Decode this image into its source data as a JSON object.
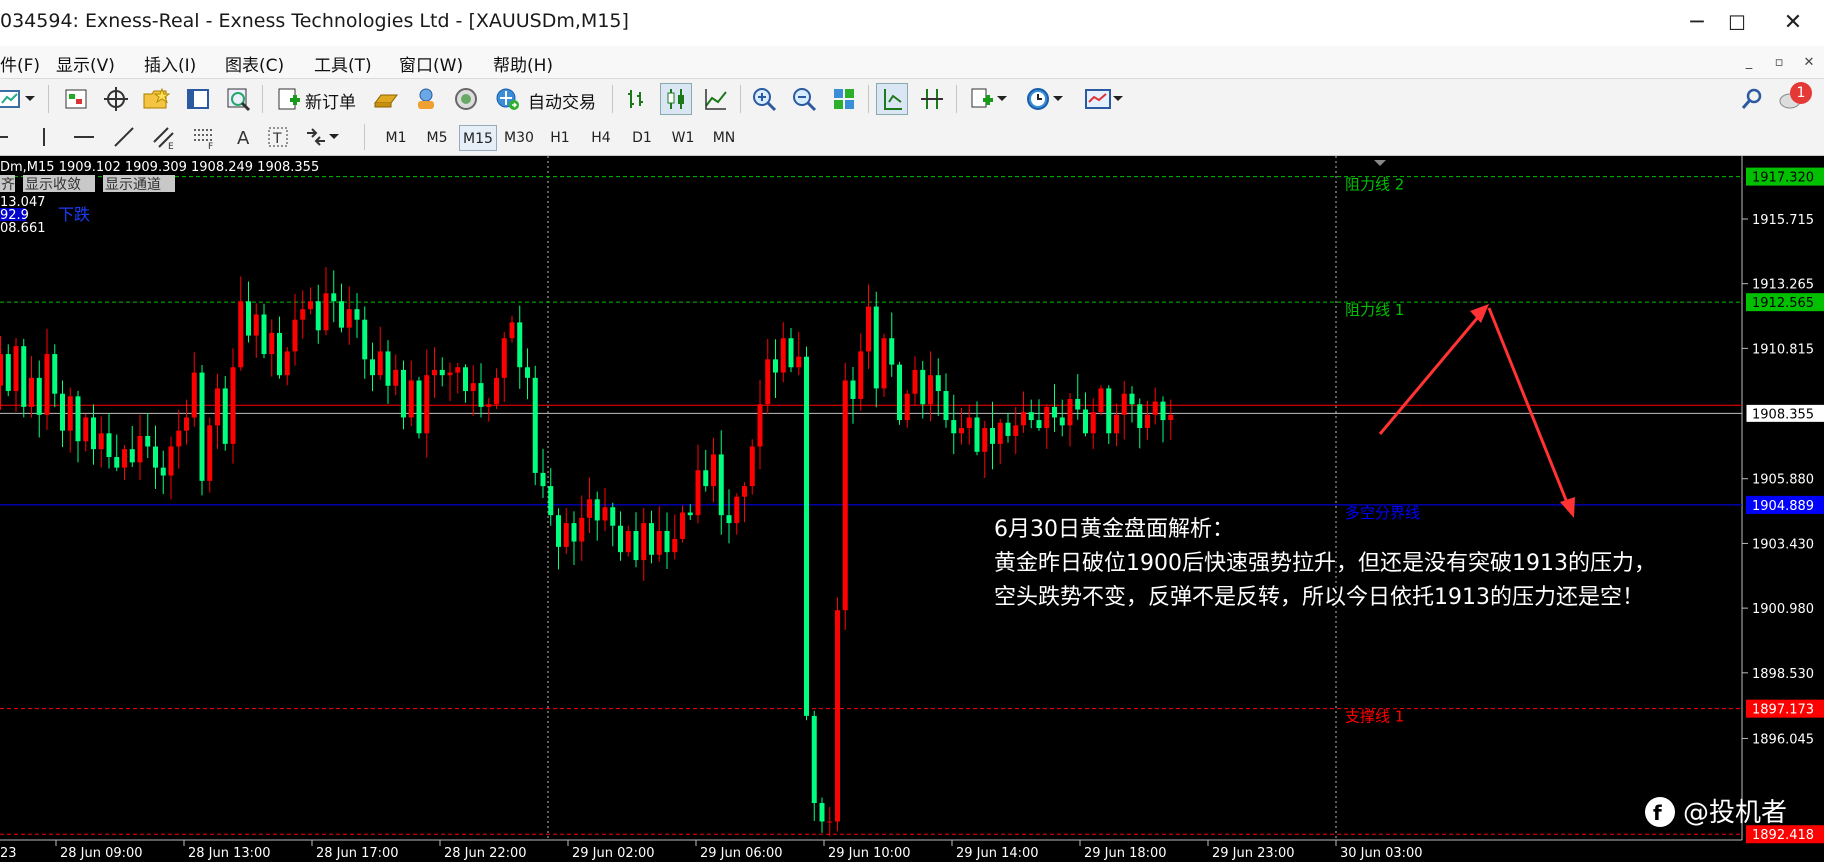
{
  "window": {
    "title": "034594: Exness-Real - Exness Technologies Ltd - [XAUUSDm,M15]",
    "minimize": "─",
    "maximize": "☐",
    "close": "✕"
  },
  "menu": [
    "件(F)",
    "显示(V)",
    "插入(I)",
    "图表(C)",
    "工具(T)",
    "窗口(W)",
    "帮助(H)"
  ],
  "mdi_controls": [
    "_",
    "▫",
    "✕"
  ],
  "toolbar": {
    "new_order_label": "新订单",
    "autotrade_label": "自动交易",
    "notification_count": "1"
  },
  "timeframes": [
    "M1",
    "M5",
    "M15",
    "M30",
    "H1",
    "H4",
    "D1",
    "W1",
    "MN"
  ],
  "active_timeframe": "M15",
  "chart_header": {
    "ohlc": "Dm,M15  1909.102 1909.309 1908.249 1908.355",
    "buttons": [
      "齐",
      "显示收敛",
      "显示通道"
    ],
    "indicator_lines": [
      "13.047",
      "92.9",
      "08.661"
    ],
    "indicator_signal": "下跌"
  },
  "chart_data": {
    "type": "candlestick",
    "symbol": "XAUUSDm",
    "timeframe": "M15",
    "ylim": [
      1892.2,
      1918.1
    ],
    "y_ticks": [
      "1915.715",
      "1913.265",
      "1910.815",
      "1905.880",
      "1903.430",
      "1900.980",
      "1898.530",
      "1896.045"
    ],
    "x_ticks": [
      "28 Jun 09:00",
      "28 Jun 13:00",
      "28 Jun 17:00",
      "28 Jun 22:00",
      "29 Jun 02:00",
      "29 Jun 06:00",
      "29 Jun 10:00",
      "29 Jun 14:00",
      "29 Jun 18:00",
      "29 Jun 23:00",
      "30 Jun 03:00"
    ],
    "x_tick_left_partial": "23",
    "current_price": "1908.355",
    "levels": [
      {
        "label": "阻力线 2",
        "value": "1917.320",
        "price": 1917.32,
        "color": "#00c000",
        "style": "dashed"
      },
      {
        "label": "阻力线 1",
        "value": "1912.565",
        "price": 1912.565,
        "color": "#00c000",
        "style": "dashed"
      },
      {
        "label": "多空分界线",
        "value": "1904.889",
        "price": 1904.889,
        "color": "#0000ff",
        "style": "solid"
      },
      {
        "label": "支撑线 1",
        "value": "1897.173",
        "price": 1897.173,
        "color": "#ff0000",
        "style": "dashed"
      },
      {
        "label": "",
        "value": "1892.418",
        "price": 1892.418,
        "color": "#ff0000",
        "style": "dashed"
      }
    ],
    "bid_line": 1908.355,
    "ask_line": 1908.55,
    "path": [
      1909.4,
      1910.6,
      1909.2,
      1910.9,
      1908.6,
      1909.7,
      1908.3,
      1910.6,
      1909.1,
      1907.7,
      1909.0,
      1907.3,
      1908.2,
      1907.0,
      1907.6,
      1906.7,
      1906.3,
      1907.0,
      1906.5,
      1907.5,
      1907.1,
      1906.3,
      1906.0,
      1907.1,
      1907.7,
      1908.2,
      1909.9,
      1905.8,
      1907.9,
      1909.3,
      1907.2,
      1910.1,
      1912.6,
      1911.3,
      1912.1,
      1910.6,
      1911.4,
      1909.8,
      1910.7,
      1911.9,
      1912.3,
      1912.6,
      1911.5,
      1912.9,
      1912.6,
      1911.6,
      1912.3,
      1911.9,
      1910.4,
      1909.8,
      1910.7,
      1909.4,
      1910.0,
      1908.2,
      1909.6,
      1907.6,
      1909.8,
      1910.0,
      1909.8,
      1909.9,
      1910.1,
      1909.2,
      1909.5,
      1908.6,
      1908.7,
      1909.7,
      1911.2,
      1911.8,
      1910.1,
      1909.7,
      1906.1,
      1905.6,
      1904.5,
      1903.3,
      1904.2,
      1903.5,
      1904.4,
      1905.1,
      1904.3,
      1904.8,
      1904.1,
      1903.1,
      1903.9,
      1902.8,
      1904.2,
      1903.0,
      1903.9,
      1903.1,
      1903.6,
      1904.6,
      1904.5,
      1906.2,
      1905.6,
      1906.8,
      1904.5,
      1904.2,
      1905.2,
      1905.6,
      1907.1,
      1908.7,
      1910.4,
      1909.9,
      1911.2,
      1910.1,
      1910.5,
      1896.9,
      1893.6,
      1892.9,
      1892.9,
      1900.9,
      1909.6,
      1908.9,
      1910.7,
      1912.4,
      1909.3,
      1911.2,
      1910.2,
      1908.1,
      1909.1,
      1910.0,
      1908.7,
      1909.8,
      1909.2,
      1908.1,
      1907.6,
      1907.8,
      1908.2,
      1906.9,
      1907.8,
      1907.2,
      1908.0,
      1907.5,
      1907.9,
      1908.4,
      1908.1,
      1907.8,
      1908.6,
      1908.2,
      1907.9,
      1908.9,
      1908.5,
      1907.6,
      1908.4,
      1909.3,
      1907.6,
      1908.3,
      1909.1,
      1908.7,
      1907.8,
      1908.3,
      1908.8,
      1908.1,
      1908.3
    ]
  },
  "annotation": {
    "title": "6月30日黄金盘面解析：",
    "line1": "黄金昨日破位1900后快速强势拉升，但还是没有突破1913的压力，",
    "line2": "空头跌势不变，反弹不是反转，所以今日依托1913的压力还是空！"
  },
  "watermark": "@投机者",
  "colors": {
    "bull": "#ff0000",
    "bear": "#00ff7f",
    "grid": "#c0c0c0",
    "axis_text": "#ffffff",
    "arrow": "#ff3333"
  }
}
